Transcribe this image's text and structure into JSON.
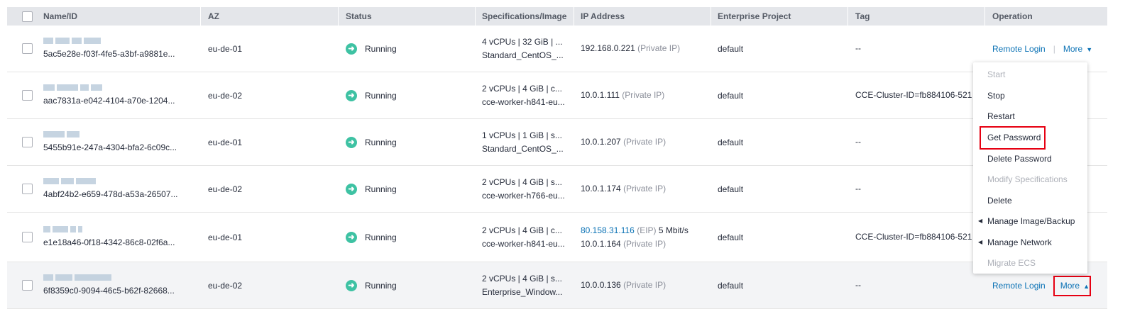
{
  "table": {
    "columns": [
      "Name/ID",
      "AZ",
      "Status",
      "Specifications/Image",
      "IP Address",
      "Enterprise Project",
      "Tag",
      "Operation"
    ],
    "rows": [
      {
        "id": "5ac5e28e-f03f-4fe5-a3bf-a9881e...",
        "az": "eu-de-01",
        "status": "Running",
        "spec1": "4 vCPUs | 32 GiB | ...",
        "spec2": "Standard_CentOS_...",
        "ip1": "192.168.0.221",
        "ip1_type": "(Private IP)",
        "ip1_extra": "",
        "ip2": "",
        "ip2_type": "",
        "ep": "default",
        "tag": "--",
        "op_login": "Remote Login",
        "op_more": "More"
      },
      {
        "id": "aac7831a-e042-4104-a70e-1204...",
        "az": "eu-de-02",
        "status": "Running",
        "spec1": "2 vCPUs | 4 GiB | c...",
        "spec2": "cce-worker-h841-eu...",
        "ip1": "10.0.1.111",
        "ip1_type": "(Private IP)",
        "ip1_extra": "",
        "ip2": "",
        "ip2_type": "",
        "ep": "default",
        "tag": "CCE-Cluster-ID=fb884106-521...",
        "op_login": "",
        "op_more": ""
      },
      {
        "id": "5455b91e-247a-4304-bfa2-6c09c...",
        "az": "eu-de-01",
        "status": "Running",
        "spec1": "1 vCPUs | 1 GiB | s...",
        "spec2": "Standard_CentOS_...",
        "ip1": "10.0.1.207",
        "ip1_type": "(Private IP)",
        "ip1_extra": "",
        "ip2": "",
        "ip2_type": "",
        "ep": "default",
        "tag": "--",
        "op_login": "",
        "op_more": ""
      },
      {
        "id": "4abf24b2-e659-478d-a53a-26507...",
        "az": "eu-de-02",
        "status": "Running",
        "spec1": "2 vCPUs | 4 GiB | s...",
        "spec2": "cce-worker-h766-eu...",
        "ip1": "10.0.1.174",
        "ip1_type": "(Private IP)",
        "ip1_extra": "",
        "ip2": "",
        "ip2_type": "",
        "ep": "default",
        "tag": "--",
        "op_login": "",
        "op_more": ""
      },
      {
        "id": "e1e18a46-0f18-4342-86c8-02f6a...",
        "az": "eu-de-01",
        "status": "Running",
        "spec1": "2 vCPUs | 4 GiB | c...",
        "spec2": "cce-worker-h841-eu...",
        "ip1": "80.158.31.116",
        "ip1_type": "(EIP)",
        "ip1_extra": "5 Mbit/s",
        "ip2": "10.0.1.164",
        "ip2_type": "(Private IP)",
        "ep": "default",
        "tag": "CCE-Cluster-ID=fb884106-521...",
        "op_login": "",
        "op_more": ""
      },
      {
        "id": "6f8359c0-9094-46c5-b62f-82668...",
        "az": "eu-de-02",
        "status": "Running",
        "spec1": "2 vCPUs | 4 GiB | s...",
        "spec2": "Enterprise_Window...",
        "ip1": "10.0.0.136",
        "ip1_type": "(Private IP)",
        "ip1_extra": "",
        "ip2": "",
        "ip2_type": "",
        "ep": "default",
        "tag": "--",
        "op_login": "Remote Login",
        "op_more": "More"
      }
    ]
  },
  "menu": {
    "items": [
      {
        "label": "Start",
        "disabled": true,
        "submenu": false
      },
      {
        "label": "Stop",
        "disabled": false,
        "submenu": false
      },
      {
        "label": "Restart",
        "disabled": false,
        "submenu": false
      },
      {
        "label": "Get Password",
        "disabled": false,
        "submenu": false
      },
      {
        "label": "Delete Password",
        "disabled": false,
        "submenu": false
      },
      {
        "label": "Modify Specifications",
        "disabled": true,
        "submenu": false
      },
      {
        "label": "Delete",
        "disabled": false,
        "submenu": false
      },
      {
        "label": "Manage Image/Backup",
        "disabled": false,
        "submenu": true
      },
      {
        "label": "Manage Network",
        "disabled": false,
        "submenu": true
      },
      {
        "label": "Migrate ECS",
        "disabled": true,
        "submenu": false
      }
    ]
  },
  "icons": {
    "status": "running-arrow-circle-icon",
    "more_open": "caret-up-icon",
    "more_closed": "caret-down-icon",
    "submenu": "caret-left-icon"
  },
  "colors": {
    "link": "#0b72b5",
    "running": "#3ec2a3",
    "highlight": "#e60012",
    "header_bg": "#e4e6ea"
  }
}
